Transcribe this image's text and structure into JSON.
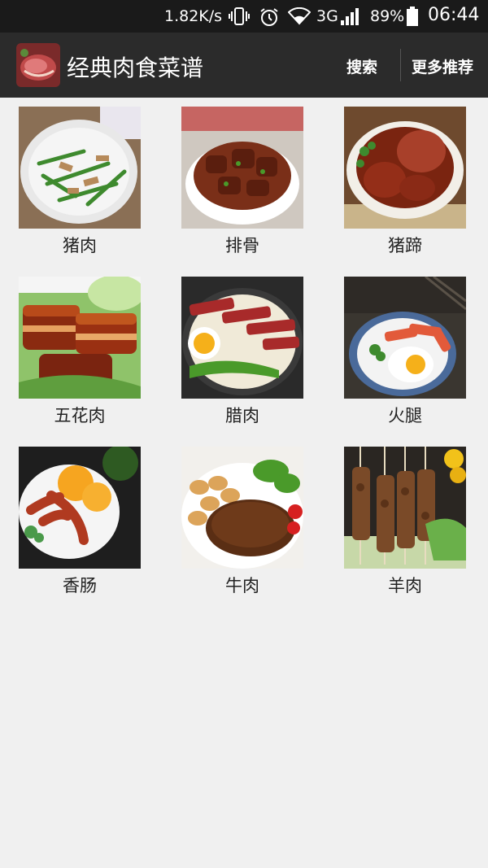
{
  "status_bar": {
    "net_speed": "1.82K/s",
    "net_type": "3G",
    "battery": "89%",
    "time": "06:44",
    "icons": [
      "vibrate-icon",
      "alarm-icon",
      "wifi-icon",
      "signal-icon",
      "battery-icon"
    ]
  },
  "app_bar": {
    "title": "经典肉食菜谱",
    "search_label": "搜索",
    "more_label": "更多推荐",
    "background": "#2b2b2b"
  },
  "categories": [
    {
      "label": "猪肉",
      "image": "stir-fried-pork-with-chives-photo"
    },
    {
      "label": "排骨",
      "image": "braised-ribs-photo"
    },
    {
      "label": "猪蹄",
      "image": "braised-trotters-photo"
    },
    {
      "label": "五花肉",
      "image": "braised-pork-belly-photo"
    },
    {
      "label": "腊肉",
      "image": "cured-meat-claypot-rice-photo"
    },
    {
      "label": "火腿",
      "image": "ham-and-egg-plate-photo"
    },
    {
      "label": "香肠",
      "image": "sausage-plate-photo"
    },
    {
      "label": "牛肉",
      "image": "steak-with-pasta-photo"
    },
    {
      "label": "羊肉",
      "image": "lamb-skewers-photo"
    }
  ]
}
